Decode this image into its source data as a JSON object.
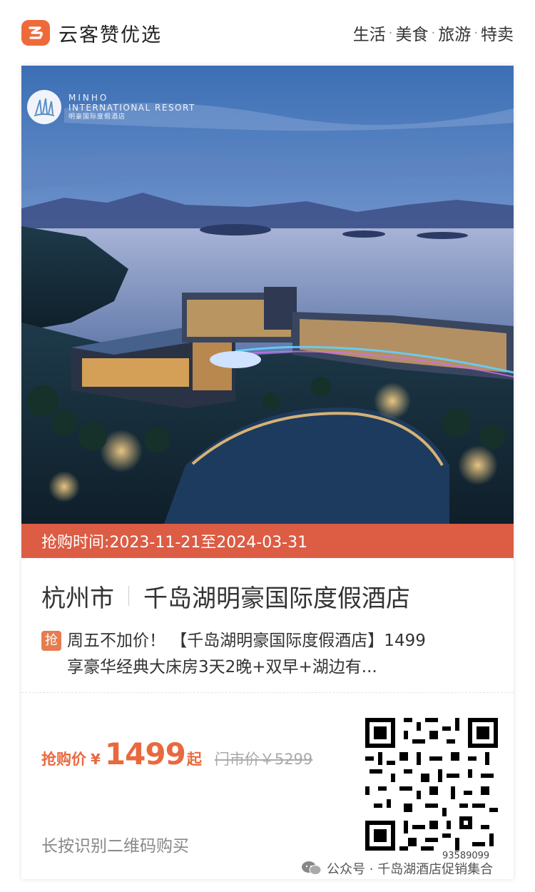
{
  "header": {
    "brand_name": "云客赞优选",
    "nav": [
      "生活",
      "美食",
      "旅游",
      "特卖"
    ],
    "nav_separator": "·"
  },
  "hero": {
    "logo_line1": "MINHO",
    "logo_line2": "INTERNATIONAL RESORT",
    "logo_line3": "明豪国际度假酒店"
  },
  "deal": {
    "time_text": "抢购时间:2023-11-21至2024-03-31"
  },
  "listing": {
    "city": "杭州市",
    "hotel_name": "千岛湖明豪国际度假酒店",
    "badge": "抢",
    "desc_line1": "周五不加价！ 【千岛湖明豪国际度假酒店】1499",
    "desc_line2": "享豪华经典大床房3天2晚+双早+湖边有..."
  },
  "price": {
    "label": "抢购价",
    "currency": "¥",
    "value": "1499",
    "suffix": "起",
    "original": "门市价￥5299"
  },
  "qr": {
    "id": "93589099"
  },
  "hint": "长按识别二维码购买",
  "watermark": {
    "text": "公众号 · 千岛湖酒店促销集合"
  },
  "colors": {
    "accent": "#e9693f",
    "deal_bar": "#dc5c44",
    "brand_logo": "#ef6a3a"
  }
}
